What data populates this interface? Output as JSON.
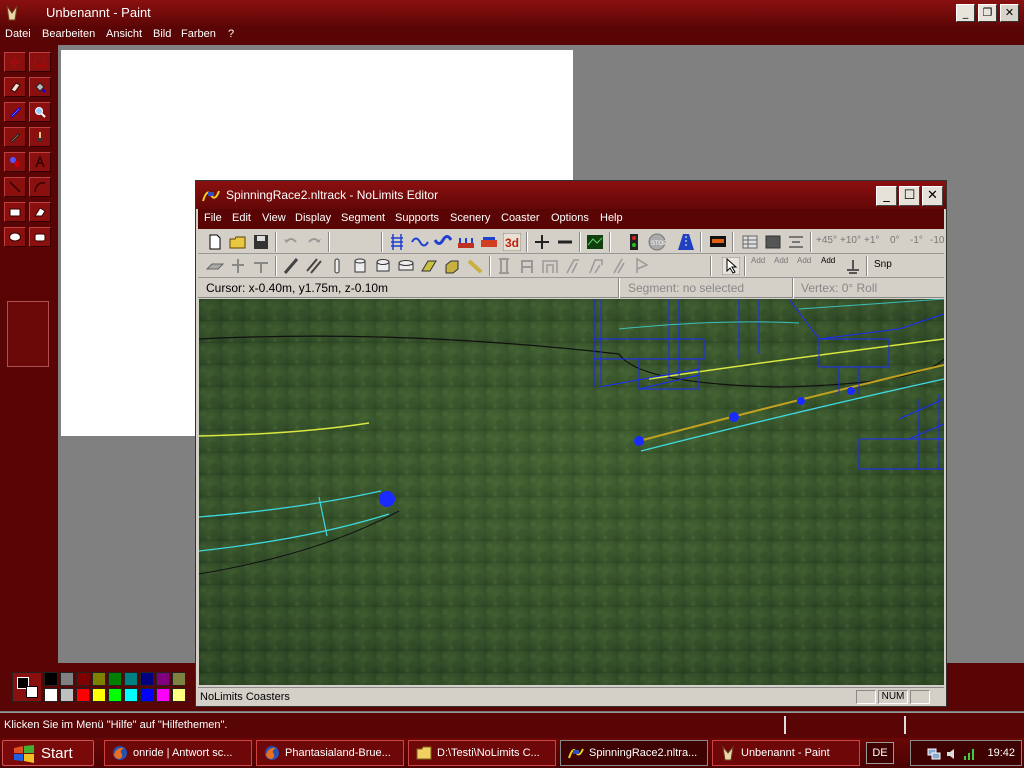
{
  "paint": {
    "title": "Unbenannt - Paint",
    "menu": [
      "Datei",
      "Bearbeiten",
      "Ansicht",
      "Bild",
      "Farben",
      "?"
    ],
    "status_text": "Klicken Sie im Menü \"Hilfe\" auf \"Hilfethemen\".",
    "palette_row1": [
      "#000000",
      "#808080",
      "#800000",
      "#808000",
      "#008000",
      "#008080",
      "#000080",
      "#800080",
      "#808040"
    ],
    "palette_row2": [
      "#ffffff",
      "#c0c0c0",
      "#ff0000",
      "#ffff00",
      "#00ff00",
      "#00ffff",
      "#0000ff",
      "#ff00ff",
      "#ffff80"
    ]
  },
  "nolimits": {
    "title": "SpinningRace2.nltrack - NoLimits Editor",
    "menu": [
      "File",
      "Edit",
      "View",
      "Display",
      "Segment",
      "Supports",
      "Scenery",
      "Coaster",
      "Options",
      "Help"
    ],
    "toolbar_labels": {
      "plus45": "+45°",
      "plus10": "+10°",
      "plus1": "+1°",
      "zero": "0°",
      "minus1": "-1°",
      "minus10": "-10",
      "snp": "Snp",
      "add": "Add"
    },
    "info": {
      "cursor": "Cursor: x-0.40m, y1.75m, z-0.10m",
      "segment": "Segment: no selected",
      "vertex": "Vertex: 0° Roll"
    },
    "status_text": "NoLimits Coasters",
    "num_label": "NUM"
  },
  "taskbar": {
    "start_label": "Start",
    "tasks": [
      "onride | Antwort sc...",
      "Phantasialand-Brue...",
      "D:\\Testi\\NoLimits C...",
      "SpinningRace2.nltra...",
      "Unbenannt - Paint"
    ],
    "language": "DE",
    "clock": "19:42"
  },
  "colors": {
    "accent": "#8a1010",
    "menubar": "#5a0505",
    "track_blue": "#1a2bff",
    "track_cyan": "#3fd8e0",
    "track_yellow": "#d8e840"
  }
}
